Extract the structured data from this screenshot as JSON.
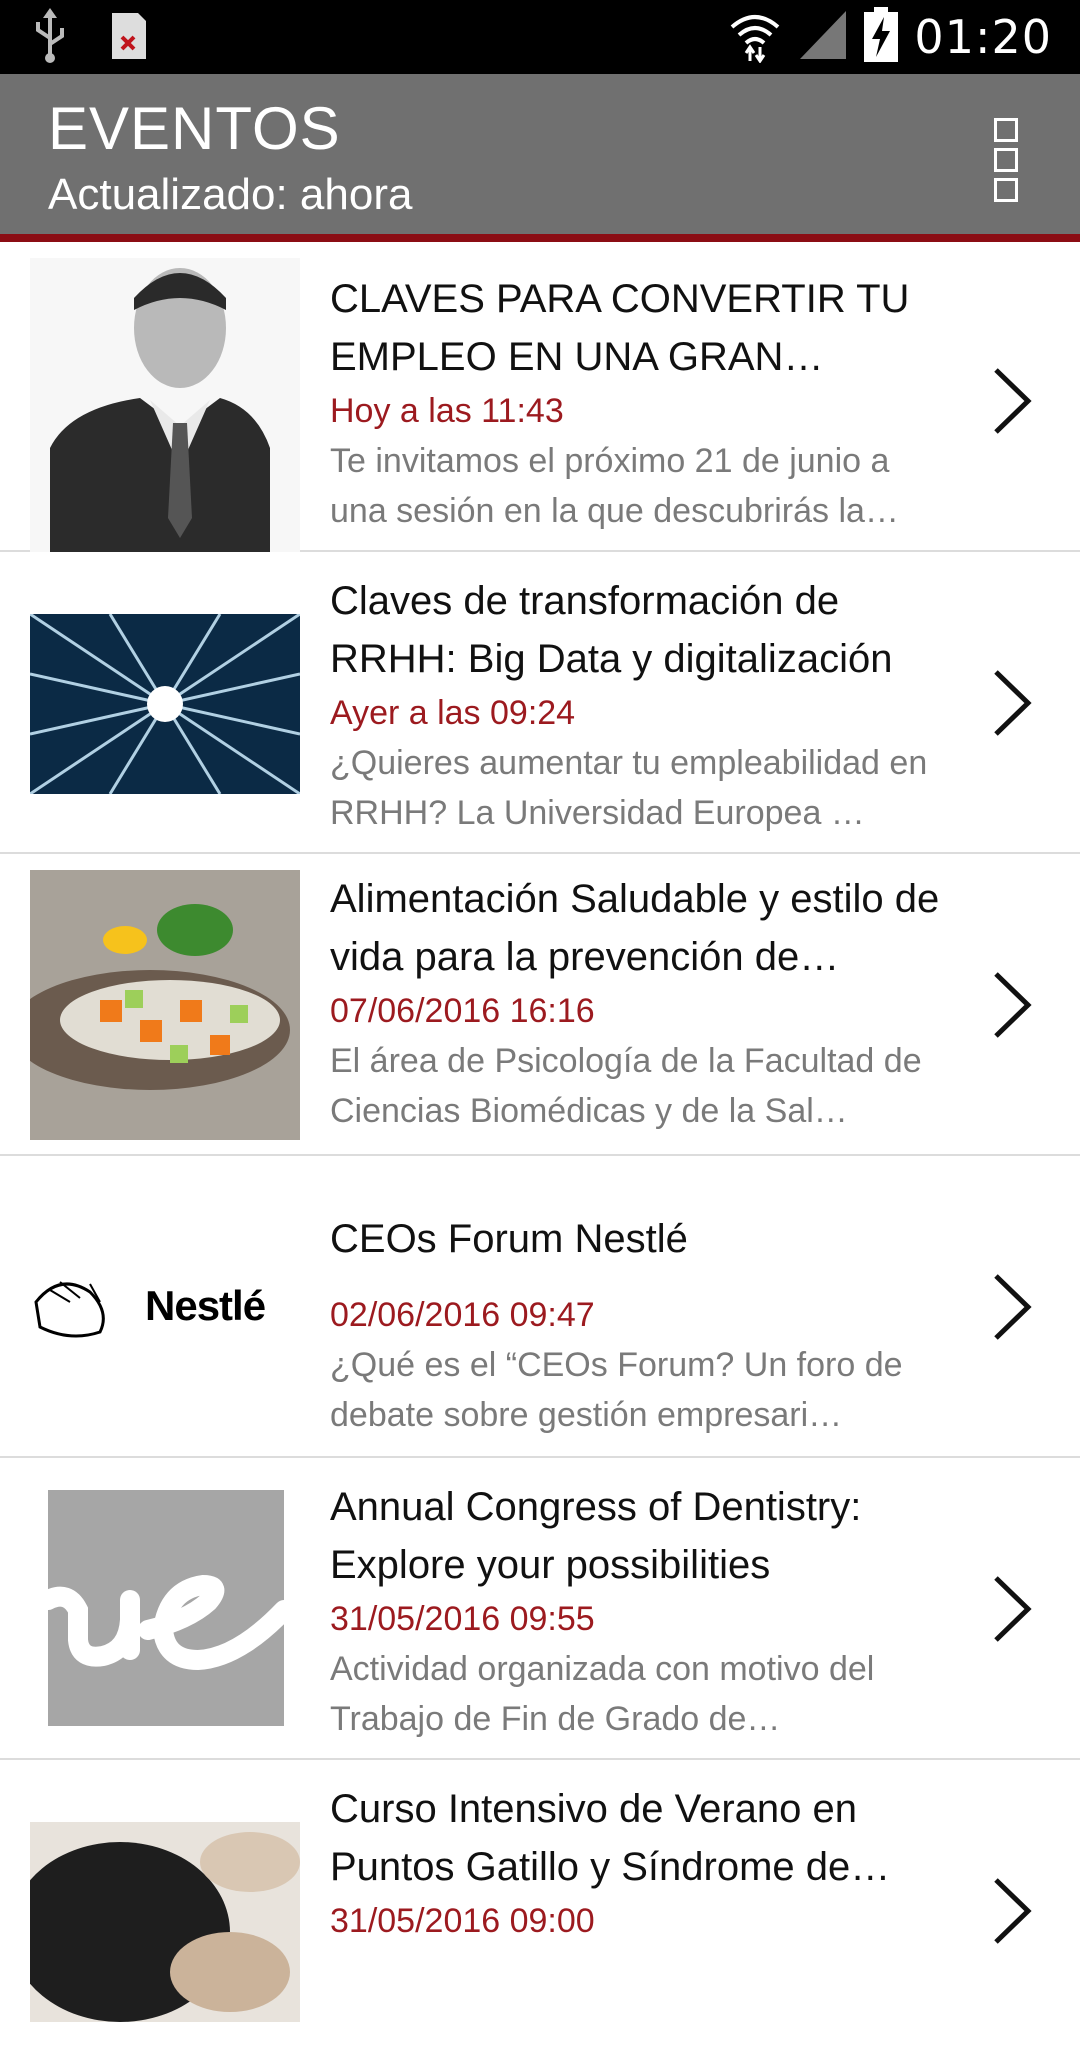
{
  "status_bar": {
    "time": "01:20",
    "icons": [
      "usb-icon",
      "app-error-icon",
      "wifi-icon",
      "signal-icon",
      "battery-charging-icon"
    ]
  },
  "app_bar": {
    "title": "EVENTOS",
    "subtitle": "Actualizado: ahora",
    "menu_icon": "overflow-menu-icon"
  },
  "events": [
    {
      "title": "CLAVES PARA CONVERTIR TU EMPLEO EN UNA GRAN…",
      "date": "Hoy a las 11:43",
      "description": "Te invitamos el próximo 21 de junio a una sesión en la que descubrirás la…",
      "thumbnail": "portrait-man-suit"
    },
    {
      "title": "Claves de transformación de RRHH: Big Data y digitalización",
      "date": "Ayer a las 09:24",
      "description": "¿Quieres aumentar tu empleabilidad en RRHH? La Universidad Europea …",
      "thumbnail": "data-tunnel"
    },
    {
      "title": "Alimentación Saludable y estilo de vida para la prevención de…",
      "date": "07/06/2016 16:16",
      "description": "El área de Psicología de la Facultad de Ciencias Biomédicas y de la Sal…",
      "thumbnail": "healthy-food"
    },
    {
      "title": "CEOs Forum Nestlé",
      "date": "02/06/2016 09:47",
      "description": "¿Qué es el “CEOs Forum?  Un foro de debate sobre gestión empresari…",
      "thumbnail": "nestle-logo",
      "logo_text": "Nestlé"
    },
    {
      "title": "Annual Congress of Dentistry: Explore your possibilities",
      "date": "31/05/2016 09:55",
      "description": "Actividad organizada con motivo del Trabajo de Fin de Grado de…",
      "thumbnail": "ue-logo",
      "logo_text": "ue"
    },
    {
      "title": "Curso Intensivo de Verano en Puntos Gatillo y Síndrome de…",
      "date": "31/05/2016 09:00",
      "description": "",
      "thumbnail": "hands-treatment"
    }
  ],
  "colors": {
    "status_bar": "#000000",
    "app_bar": "#707070",
    "accent": "#8b0d14",
    "date_text": "#9c1a1f",
    "description_text": "#7a7a7a"
  }
}
